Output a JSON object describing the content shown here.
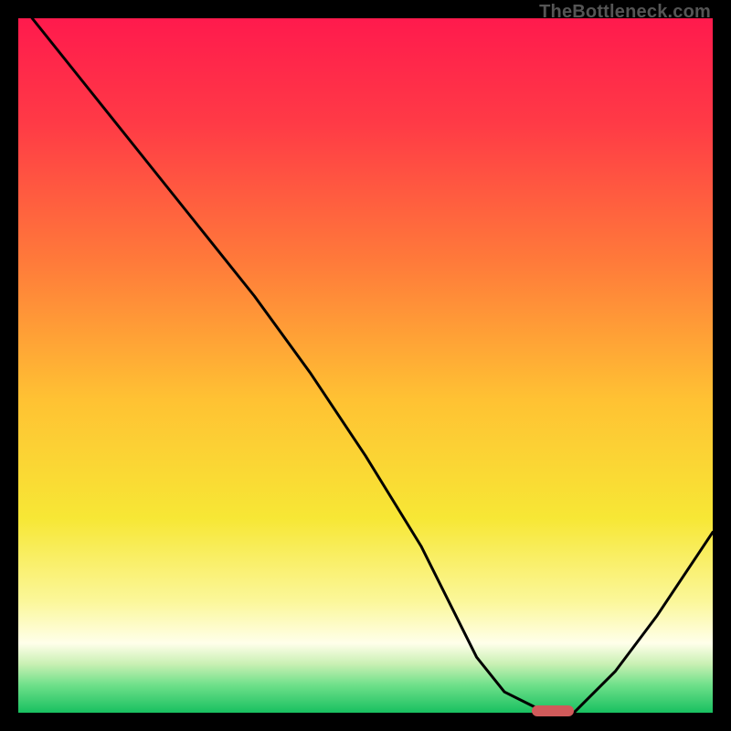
{
  "watermark": "TheBottleneck.com",
  "colors": {
    "bg": "#000000",
    "gradient_stops": [
      {
        "offset": 0,
        "color": "#ff1a4d"
      },
      {
        "offset": 0.15,
        "color": "#ff3a46"
      },
      {
        "offset": 0.35,
        "color": "#ff7a3a"
      },
      {
        "offset": 0.55,
        "color": "#ffc233"
      },
      {
        "offset": 0.72,
        "color": "#f7e735"
      },
      {
        "offset": 0.84,
        "color": "#fbf79a"
      },
      {
        "offset": 0.9,
        "color": "#ffffea"
      },
      {
        "offset": 0.93,
        "color": "#c9f0b3"
      },
      {
        "offset": 0.96,
        "color": "#6fe08a"
      },
      {
        "offset": 1.0,
        "color": "#18c060"
      }
    ],
    "curve": "#000000",
    "marker": "#d05a5a"
  },
  "chart_data": {
    "type": "line",
    "title": "",
    "xlabel": "",
    "ylabel": "",
    "xlim": [
      0,
      100
    ],
    "ylim": [
      0,
      100
    ],
    "grid": false,
    "legend": false,
    "series": [
      {
        "name": "bottleneck-curve",
        "x": [
          2,
          10,
          18,
          26,
          34,
          42,
          50,
          58,
          63,
          66,
          70,
          74,
          76,
          80,
          86,
          92,
          100
        ],
        "y": [
          100,
          90,
          80,
          70,
          60,
          49,
          37,
          24,
          14,
          8,
          3,
          1,
          0,
          0,
          6,
          14,
          26
        ]
      }
    ],
    "marker": {
      "x_start": 74,
      "x_end": 80,
      "y": 0
    }
  }
}
